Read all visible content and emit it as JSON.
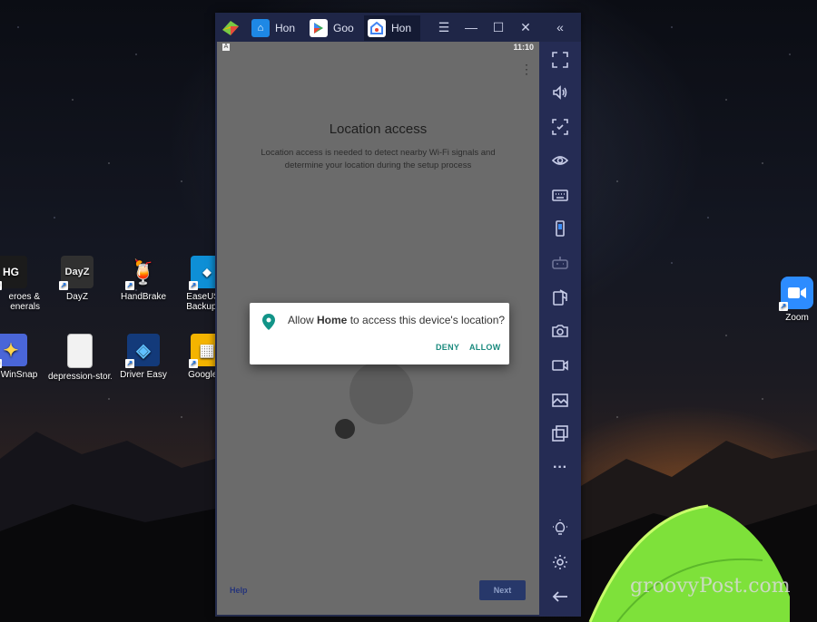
{
  "desktop": {
    "icons": [
      {
        "label": "eroes &",
        "label2": "enerals",
        "glyph": "HG",
        "bg": "#1b1b1b"
      },
      {
        "label": "DayZ",
        "label2": "",
        "glyph": "DayZ",
        "bg": "#303030"
      },
      {
        "label": "HandBrake",
        "label2": "",
        "glyph": "🍹",
        "bg": "transparent"
      },
      {
        "label": "EaseUS T",
        "label2": "Backup Fr",
        "glyph": "◆",
        "bg": "#0e8fd6"
      },
      {
        "label": "WinSnap",
        "label2": "",
        "glyph": "✦",
        "bg": "#4a66d8"
      },
      {
        "label": "depression-stor...",
        "label2": "",
        "glyph": "",
        "bg": "#f2f2f2"
      },
      {
        "label": "Driver Easy",
        "label2": "",
        "glyph": "◈",
        "bg": "#133a7a"
      },
      {
        "label": "Google S",
        "label2": "",
        "glyph": "▦",
        "bg": "#f4b400"
      },
      {
        "label": "Zoom",
        "label2": "",
        "glyph": "■",
        "bg": "#2d8cff"
      }
    ],
    "watermark": "groovyPost.com"
  },
  "window": {
    "tabs": [
      {
        "label": "Hon",
        "icon": "home-app-icon",
        "color": "#1e88e5"
      },
      {
        "label": "Goo",
        "icon": "play-store-icon",
        "color": "#ffffff"
      },
      {
        "label": "Hon",
        "icon": "google-home-icon",
        "color": "#ffffff"
      }
    ],
    "controls": [
      "menu-icon",
      "minimize-icon",
      "maximize-icon",
      "close-icon",
      "collapse-sidebar-icon"
    ]
  },
  "android": {
    "status_time": "11:10",
    "page_title": "Location access",
    "page_subtitle_line1": "Location access is needed to detect nearby Wi-Fi signals and",
    "page_subtitle_line2": "determine your location during the setup process",
    "help_label": "Help",
    "next_label": "Next"
  },
  "dialog": {
    "text_prefix": "Allow ",
    "text_app": "Home",
    "text_suffix": " to access this device's location?",
    "deny_label": "DENY",
    "allow_label": "ALLOW"
  },
  "sidebar_icons": [
    "fullscreen-icon",
    "volume-icon",
    "screenshot-area-icon",
    "eye-icon",
    "keyboard-icon",
    "device-rotate-icon",
    "gamepad-icon",
    "install-apk-icon",
    "camera-icon",
    "record-icon",
    "media-folder-icon",
    "multi-instance-icon",
    "more-icon",
    "bulb-icon",
    "settings-icon",
    "back-icon"
  ]
}
